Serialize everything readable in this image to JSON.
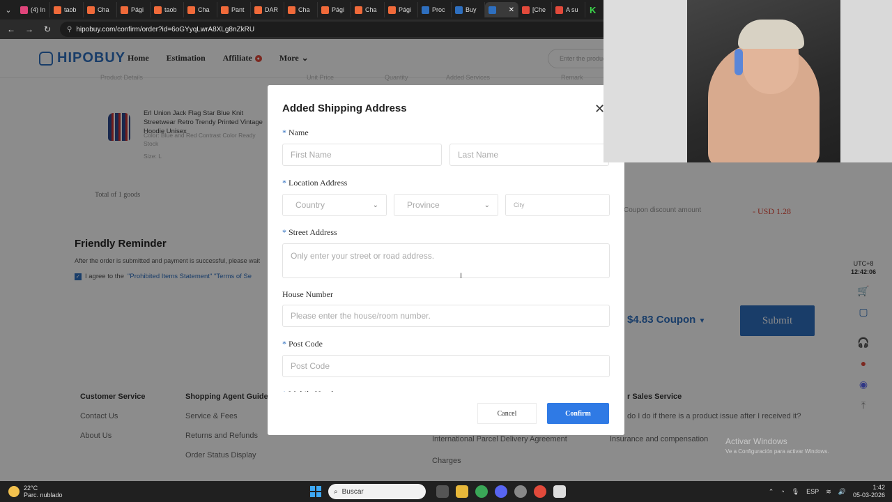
{
  "browser": {
    "tabs": [
      {
        "label": "(4) In",
        "color": "#e0457b"
      },
      {
        "label": "taob",
        "color": "#f06a3a"
      },
      {
        "label": "Cha",
        "color": "#f06a3a"
      },
      {
        "label": "Pági",
        "color": "#f06a3a"
      },
      {
        "label": "taob",
        "color": "#f06a3a"
      },
      {
        "label": "Cha",
        "color": "#f06a3a"
      },
      {
        "label": "Pant",
        "color": "#f06a3a"
      },
      {
        "label": "DAR",
        "color": "#f06a3a"
      },
      {
        "label": "Cha",
        "color": "#f06a3a"
      },
      {
        "label": "Pági",
        "color": "#f06a3a"
      },
      {
        "label": "Cha",
        "color": "#f06a3a"
      },
      {
        "label": "Pági",
        "color": "#f06a3a"
      },
      {
        "label": "Proc",
        "color": "#2e6fbf"
      },
      {
        "label": "Buy",
        "color": "#2e6fbf"
      },
      {
        "label": "",
        "color": "#2e6fbf",
        "active": true
      },
      {
        "label": "[Che",
        "color": "#e24a3b"
      },
      {
        "label": "A su",
        "color": "#e24a3b"
      }
    ],
    "url": "hipobuy.com/confirm/order?id=6oGYyqLwrA8XLg8nZkRU"
  },
  "site": {
    "logo": "HIPOBUY",
    "nav": {
      "home": "Home",
      "estimation": "Estimation",
      "affiliate": "Affiliate",
      "affiliate_badge": "",
      "more": "More"
    },
    "search_placeholder": "Enter the product"
  },
  "order": {
    "column_headers": [
      "Product Details",
      "Unit Price",
      "Quantity",
      "Added Services",
      "Remark"
    ],
    "product": {
      "title": "Erl Union Jack Flag Star Blue Knit Streetwear Retro Trendy Printed Vintage Hoodie Unisex",
      "color": "Color:  Blue and Red Contrast Color Ready Stock",
      "size": "Size:  L"
    },
    "total": "Total of 1 goods",
    "coupon_discount_label": "Coupon discount amount",
    "coupon_discount_value": "- USD 1.28",
    "reminder_title": "Friendly Reminder",
    "reminder_text": "After the order is submitted and payment is successful, please wait",
    "agree_prefix": "I agree to the",
    "agree_links": "\"Prohibited Items Statement\" \"Terms of Se",
    "coupon_select": "$4.83 Coupon",
    "submit": "Submit"
  },
  "rail": {
    "timezone": "UTC+8",
    "time": "12:42:06"
  },
  "footer": {
    "customer_service": {
      "heading": "Customer Service",
      "links": [
        "Contact Us",
        "About Us"
      ]
    },
    "shopping_agent": {
      "heading": "Shopping Agent Guide",
      "links": [
        "Service & Fees",
        "Returns and Refunds",
        "Order Status Display"
      ]
    },
    "international_links": [
      "International Parcel Delivery Agreement",
      "Charges"
    ],
    "after_sales": {
      "heading": "r Sales Service",
      "links": [
        "do I do if there is a product issue after I received it?",
        "Insurance and compensation"
      ]
    }
  },
  "watermark": {
    "line1": "Activar Windows",
    "line2": "Ve a Configuración para activar Windows."
  },
  "modal": {
    "title": "Added Shipping Address",
    "name_label": "Name",
    "first_name_placeholder": "First Name",
    "last_name_placeholder": "Last Name",
    "location_label": "Location Address",
    "country_placeholder": "Country",
    "province_placeholder": "Province",
    "city_placeholder": "City",
    "street_label": "Street Address",
    "street_placeholder": "Only enter your street or road address.",
    "house_label": "House Number",
    "house_placeholder": "Please enter the house/room number.",
    "post_label": "Post Code",
    "post_placeholder": "Post Code",
    "mobile_label": "Mobile Number",
    "cancel": "Cancel",
    "confirm": "Confirm"
  },
  "taskbar": {
    "temperature": "22°C",
    "weather": "Parc. nublado",
    "search": "Buscar",
    "language": "ESP",
    "time": "1:42",
    "date": "05-03-2026"
  },
  "colors": {
    "brand": "#2e6fbf",
    "confirm": "#2f7ae5",
    "discount": "#e24a3b"
  }
}
